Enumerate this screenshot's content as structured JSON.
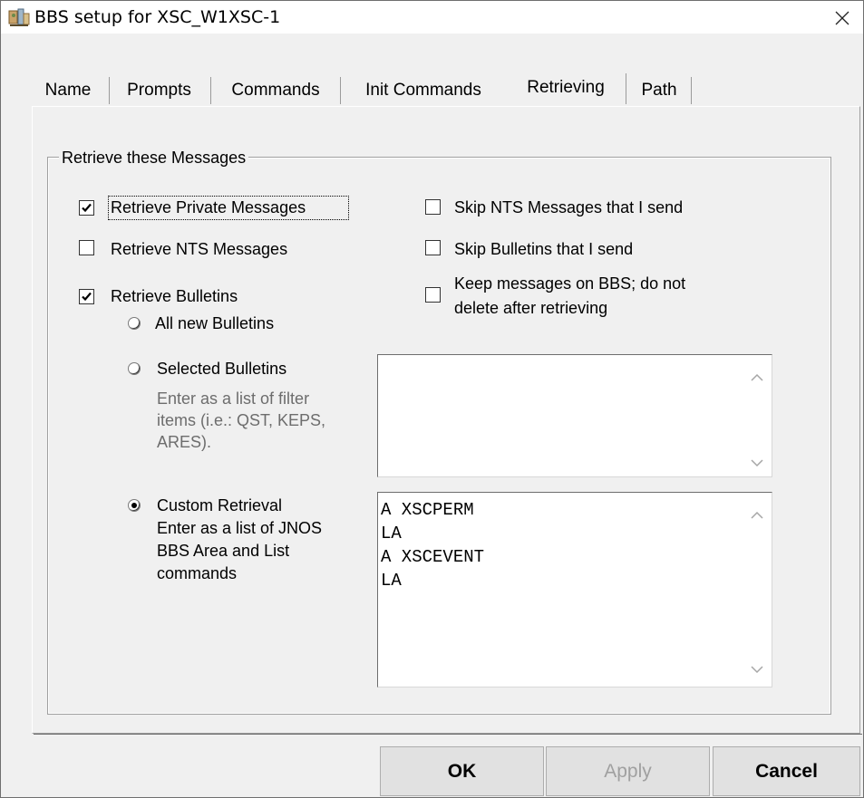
{
  "window": {
    "title": "BBS setup for XSC_W1XSC-1",
    "app_icon": "bbs-app-icon",
    "close_icon": "close-icon"
  },
  "tabs": [
    {
      "label": "Name",
      "active": false
    },
    {
      "label": "Prompts",
      "active": false
    },
    {
      "label": "Commands",
      "active": false
    },
    {
      "label": "Init Commands",
      "active": false
    },
    {
      "label": "Retrieving",
      "active": true
    },
    {
      "label": "Path",
      "active": false
    }
  ],
  "group": {
    "title": "Retrieve these Messages"
  },
  "left_options": {
    "retrieve_private": {
      "label": "Retrieve Private Messages",
      "checked": true
    },
    "retrieve_nts": {
      "label": "Retrieve NTS Messages",
      "checked": false
    },
    "retrieve_bulletins": {
      "label": "Retrieve Bulletins",
      "checked": true
    }
  },
  "right_options": {
    "skip_nts": {
      "label": "Skip NTS Messages that I send",
      "checked": false
    },
    "skip_bulletins": {
      "label": "Skip Bulletins that I send",
      "checked": false
    },
    "keep_messages": {
      "label_line1": "Keep messages on BBS; do not",
      "label_line2": "delete after retrieving",
      "checked": false
    }
  },
  "bulletin_modes": {
    "all_new": {
      "label": "All new Bulletins",
      "selected": false
    },
    "selected": {
      "label": "Selected Bulletins",
      "help_line1": "Enter as a list of filter",
      "help_line2": "items (i.e.: QST, KEPS,",
      "help_line3": "ARES).",
      "selected": false,
      "value": ""
    },
    "custom": {
      "label": "Custom Retrieval",
      "help_line1": "Enter as a list of JNOS",
      "help_line2": "BBS Area and List",
      "help_line3": "commands",
      "selected": true,
      "value": "A XSCPERM\nLA\nA XSCEVENT\nLA"
    }
  },
  "buttons": {
    "ok": "OK",
    "apply": "Apply",
    "cancel": "Cancel"
  },
  "colors": {
    "window_bg": "#f0f0f0",
    "help_text": "#6d6d6d",
    "disabled_text": "#a0a0a0"
  }
}
